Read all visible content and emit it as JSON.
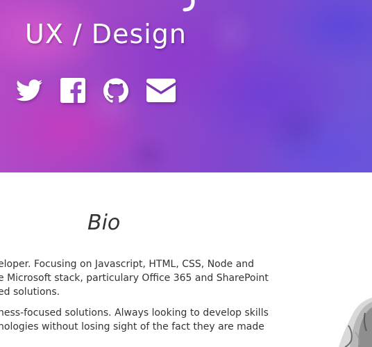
{
  "hero": {
    "subtitle": "UX / Design",
    "social": [
      {
        "id": "twitter",
        "icon": "twitter-icon"
      },
      {
        "id": "facebook",
        "icon": "facebook-icon"
      },
      {
        "id": "github",
        "icon": "github-icon"
      },
      {
        "id": "email",
        "icon": "envelope-icon"
      }
    ]
  },
  "bio": {
    "title": "Bio",
    "paragraphs": [
      {
        "lines": [
          "eloper. Focusing on Javascript, HTML, CSS, Node and",
          "e Microsoft stack, particulary Office 365 and SharePoint",
          "ed solutions."
        ]
      },
      {
        "lines": [
          "ness-focused solutions. Always looking to develop skills",
          "nologies without losing sight of the fact they are made"
        ]
      }
    ]
  },
  "colors": {
    "hero_pink": "#b74bc6",
    "hero_violet": "#6c56d6",
    "text": "#333333",
    "icon": "#ffffff"
  }
}
